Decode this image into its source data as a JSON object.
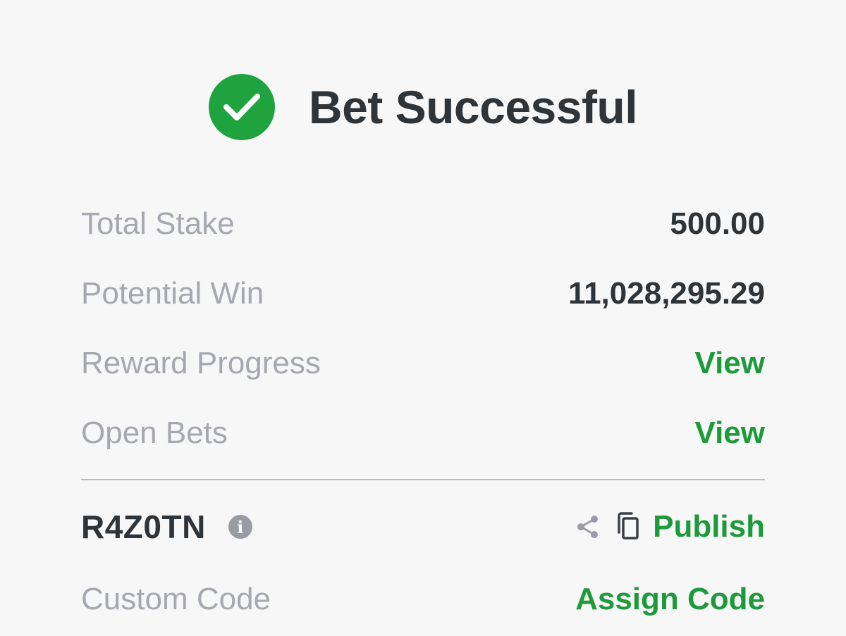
{
  "header": {
    "title": "Bet Successful",
    "status_icon": "check-circle-icon",
    "accent_color": "#1fa33f"
  },
  "summary": {
    "total_stake": {
      "label": "Total Stake",
      "value": "500.00"
    },
    "potential_win": {
      "label": "Potential Win",
      "value": "11,028,295.29"
    },
    "reward_progress": {
      "label": "Reward Progress",
      "action": "View"
    },
    "open_bets": {
      "label": "Open Bets",
      "action": "View"
    }
  },
  "booking": {
    "code": "R4Z0TN",
    "info_icon": "info-icon",
    "share_icon": "share-icon",
    "copy_icon": "copy-icon",
    "publish_label": "Publish"
  },
  "custom_code": {
    "label": "Custom Code",
    "action": "Assign Code"
  },
  "colors": {
    "label": "#a6a8b0",
    "value": "#2f3438",
    "link": "#1e9a3a"
  }
}
